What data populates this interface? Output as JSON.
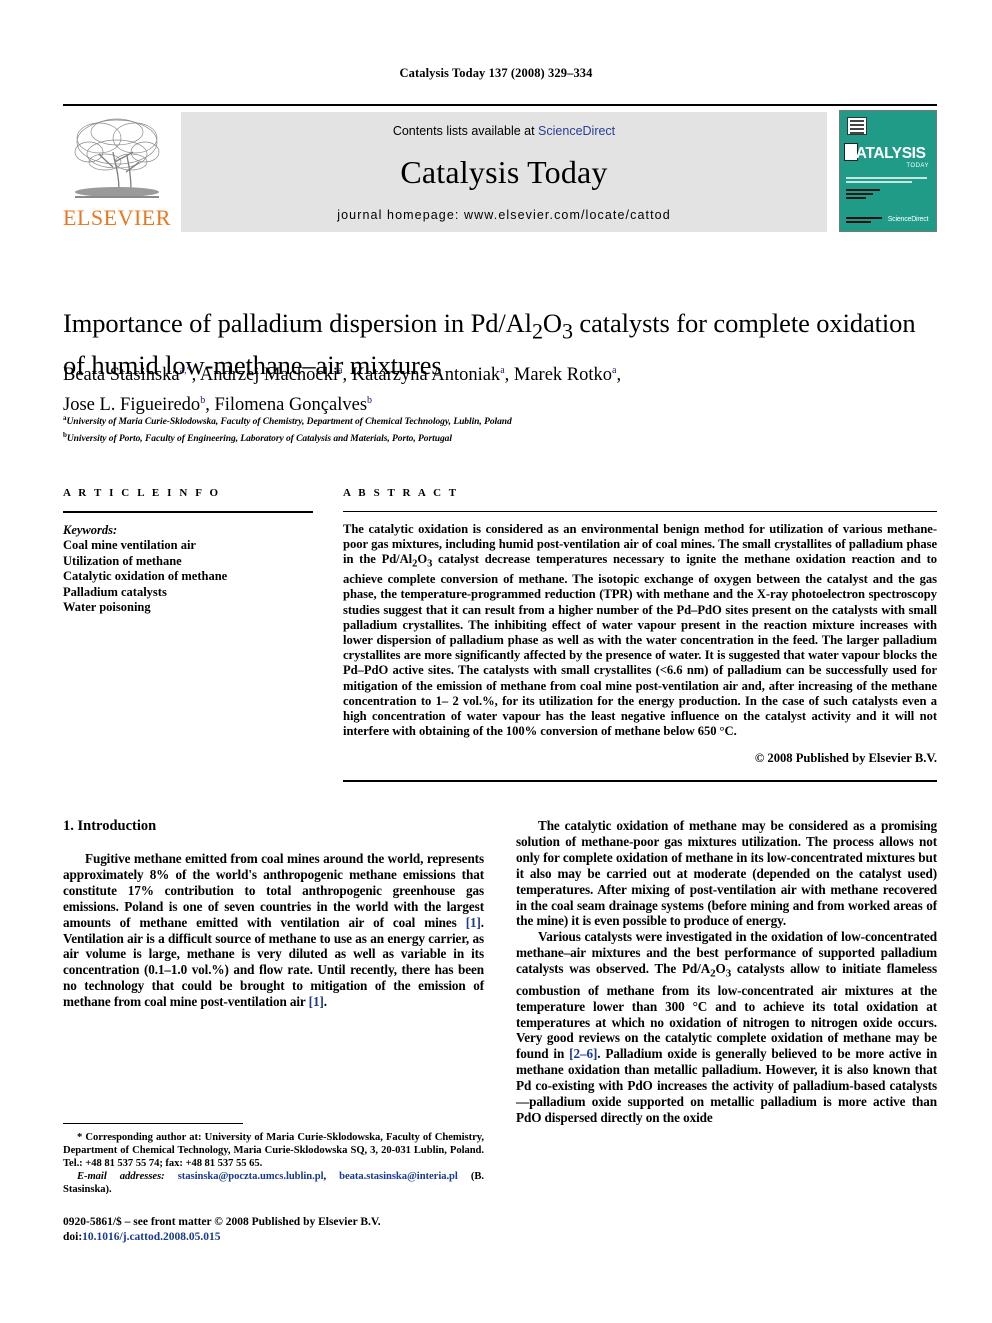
{
  "running_head": "Catalysis Today 137 (2008) 329–334",
  "masthead": {
    "publisher_name": "ELSEVIER",
    "publisher_logo_alt": "elsevier-tree-logo",
    "contents_prefix": "Contents lists available at ",
    "contents_link": "ScienceDirect",
    "journal_title": "Catalysis Today",
    "homepage": "journal homepage: www.elsevier.com/locate/cattod",
    "cover": {
      "title": "CATALYSIS",
      "subtitle": "TODAY",
      "footer_brand": "ScienceDirect",
      "background_color": "#1f9b87"
    }
  },
  "article": {
    "title_line1": "Importance of palladium dispersion in Pd/Al",
    "title_sub1": "2",
    "title_mid": "O",
    "title_sub2": "3",
    "title_line1_end": " catalysts for complete oxidation",
    "title_line2": "of humid low-methane–air mixtures",
    "authors": [
      {
        "name": "Beata Stasinska",
        "marks": "a,*"
      },
      {
        "name": "Andrzej Machocki",
        "marks": "a"
      },
      {
        "name": "Katarzyna Antoniak",
        "marks": "a"
      },
      {
        "name": "Marek Rotko",
        "marks": "a"
      },
      {
        "name": "Jose L. Figueiredo",
        "marks": "b"
      },
      {
        "name": "Filomena Gonçalves",
        "marks": "b"
      }
    ],
    "affiliations": [
      {
        "mark": "a",
        "text": "University of Maria Curie-Sklodowska, Faculty of Chemistry, Department of Chemical Technology, Lublin, Poland"
      },
      {
        "mark": "b",
        "text": "University of Porto, Faculty of Engineering, Laboratory of Catalysis and Materials, Porto, Portugal"
      }
    ]
  },
  "article_info": {
    "heading": "A R T I C L E   I N F O",
    "keywords_label": "Keywords:",
    "keywords": [
      "Coal mine ventilation air",
      "Utilization of methane",
      "Catalytic oxidation of methane",
      "Palladium catalysts",
      "Water poisoning"
    ]
  },
  "abstract": {
    "heading": "A B S T R A C T",
    "text": "The catalytic oxidation is considered as an environmental benign method for utilization of various methane-poor gas mixtures, including humid post-ventilation air of coal mines. The small crystallites of palladium phase in the Pd/Al2O3 catalyst decrease temperatures necessary to ignite the methane oxidation reaction and to achieve complete conversion of methane. The isotopic exchange of oxygen between the catalyst and the gas phase, the temperature-programmed reduction (TPR) with methane and the X-ray photoelectron spectroscopy studies suggest that it can result from a higher number of the Pd–PdO sites present on the catalysts with small palladium crystallites. The inhibiting effect of water vapour present in the reaction mixture increases with lower dispersion of palladium phase as well as with the water concentration in the feed. The larger palladium crystallites are more significantly affected by the presence of water. It is suggested that water vapour blocks the Pd–PdO active sites. The catalysts with small crystallites (<6.6 nm) of palladium can be successfully used for mitigation of the emission of methane from coal mine post-ventilation air and, after increasing of the methane concentration to 1–2 vol.%, for its utilization for the energy production. In the case of such catalysts even a high concentration of water vapour has the least negative influence on the catalyst activity and it will not interfere with obtaining of the 100% conversion of methane below 650 °C.",
    "copyright": "© 2008 Published by Elsevier B.V."
  },
  "body": {
    "section_heading": "1. Introduction",
    "left_paragraphs": [
      "Fugitive methane emitted from coal mines around the world, represents approximately 8% of the world's anthropogenic methane emissions that constitute 17% contribution to total anthropogenic greenhouse gas emissions. Poland is one of seven countries in the world with the largest amounts of methane emitted with ventilation air of coal mines [1]. Ventilation air is a difficult source of methane to use as an energy carrier, as air volume is large, methane is very diluted as well as variable in its concentration (0.1–1.0 vol.%) and flow rate. Until recently, there has been no technology that could be brought to mitigation of the emission of methane from coal mine post-ventilation air [1]."
    ],
    "right_paragraphs": [
      "The catalytic oxidation of methane may be considered as a promising solution of methane-poor gas mixtures utilization. The process allows not only for complete oxidation of methane in its low-concentrated mixtures but it also may be carried out at moderate (depended on the catalyst used) temperatures. After mixing of post-ventilation air with methane recovered in the coal seam drainage systems (before mining and from worked areas of the mine) it is even possible to produce of energy.",
      "Various catalysts were investigated in the oxidation of low-concentrated methane–air mixtures and the best performance of supported palladium catalysts was observed. The Pd/A2O3 catalysts allow to initiate flameless combustion of methane from its low-concentrated air mixtures at the temperature lower than 300 °C and to achieve its total oxidation at temperatures at which no oxidation of nitrogen to nitrogen oxide occurs. Very good reviews on the catalytic complete oxidation of methane may be found in [2–6]. Palladium oxide is generally believed to be more active in methane oxidation than metallic palladium. However, it is also known that Pd co-existing with PdO increases the activity of palladium-based catalysts—palladium oxide supported on metallic palladium is more active than PdO dispersed directly on the oxide"
    ]
  },
  "footnotes": {
    "corresponding": "* Corresponding author at: University of Maria Curie-Sklodowska, Faculty of Chemistry, Department of Chemical Technology, Maria Curie-Sklodowska SQ, 3, 20-031 Lublin, Poland. Tel.: +48 81 537 55 74; fax: +48 81 537 55 65.",
    "email_label": "E-mail addresses:",
    "email_1": "stasinska@poczta.umcs.lublin.pl",
    "email_2": "beata.stasinska@interia.pl",
    "email_owner": "(B. Stasinska).",
    "imprint_line1": "0920-5861/$ – see front matter © 2008 Published by Elsevier B.V.",
    "doi_label": "doi:",
    "doi_value": "10.1016/j.cattod.2008.05.015"
  }
}
